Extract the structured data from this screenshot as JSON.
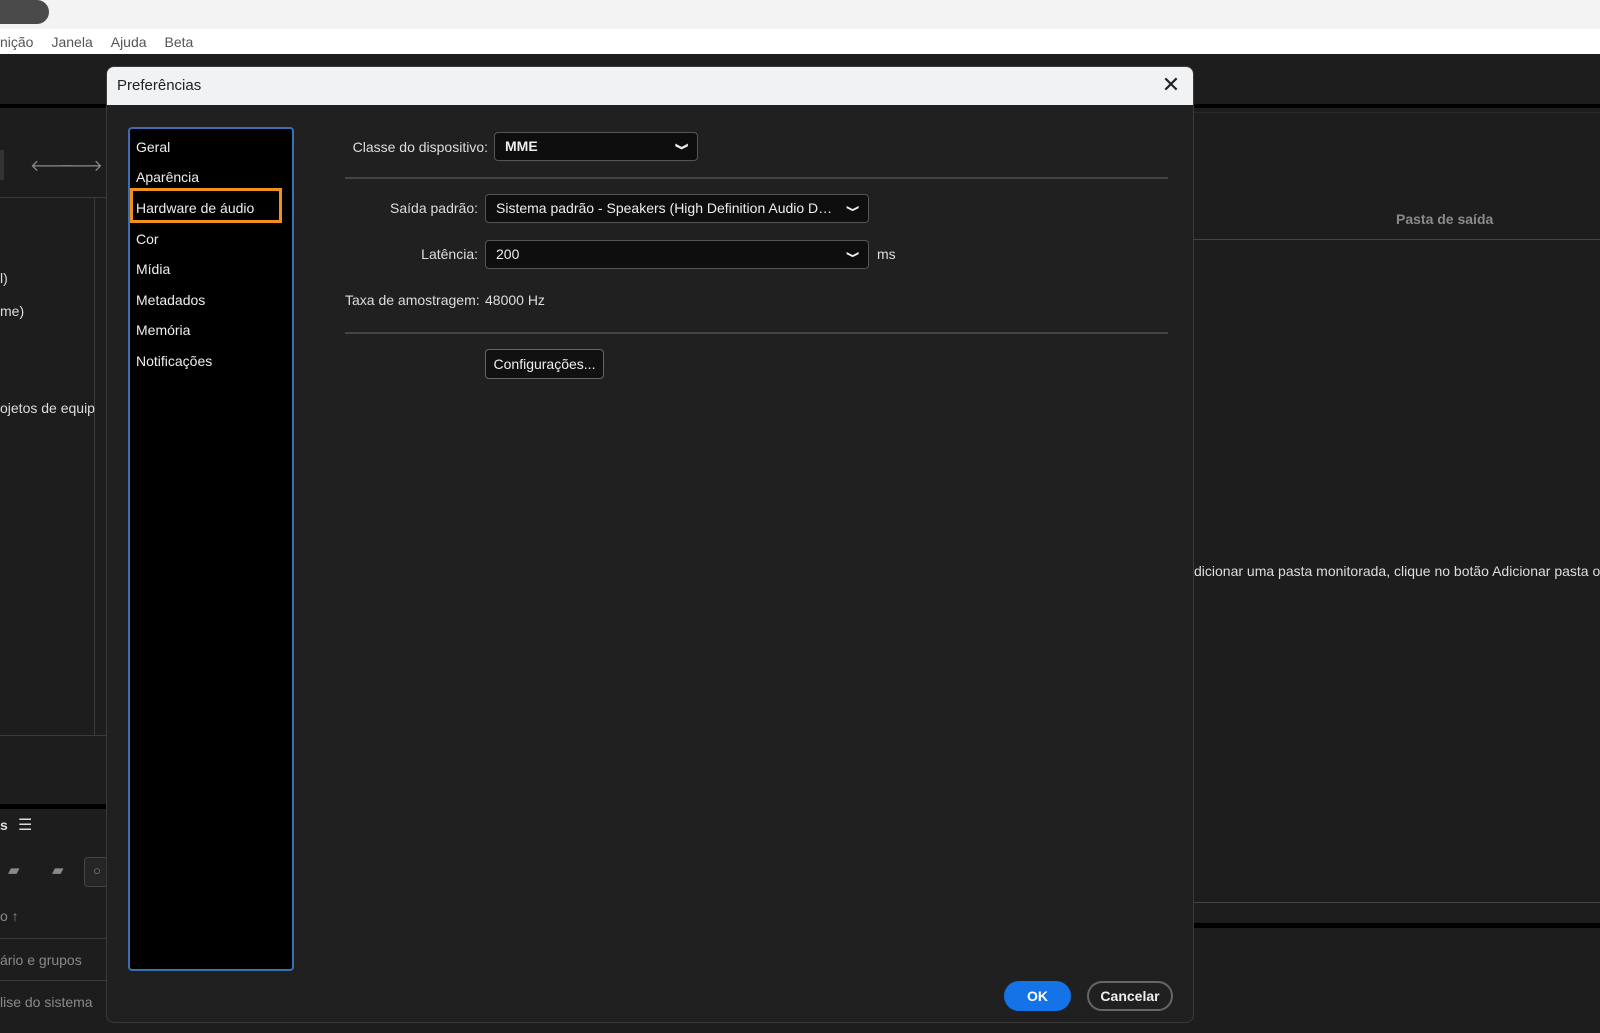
{
  "app_menu": [
    "nição",
    "Janela",
    "Ajuda",
    "Beta"
  ],
  "background": {
    "left_texts": [
      "l)",
      "me)",
      "ojetos de equip"
    ],
    "panel_label": "s",
    "sort_text": "o ↑",
    "bottom_items": [
      "ário e grupos",
      "lise do sistema"
    ],
    "right_header": "Pasta de saída",
    "right_hint": "dicionar uma pasta monitorada, clique no botão Adicionar pasta ou"
  },
  "dialog": {
    "title": "Preferências",
    "nav": [
      "Geral",
      "Aparência",
      "Hardware de áudio",
      "Cor",
      "Mídia",
      "Metadados",
      "Memória",
      "Notificações"
    ],
    "selected_nav": "Hardware de áudio",
    "device_class_label": "Classe do dispositivo:",
    "device_class_value": "MME",
    "default_output_label": "Saída padrão:",
    "default_output_value": "Sistema padrão - Speakers (High Definition Audio De...",
    "latency_label": "Latência:",
    "latency_value": "200",
    "latency_unit": "ms",
    "sample_rate_label": "Taxa de amostragem:",
    "sample_rate_value": "48000 Hz",
    "settings_button": "Configurações...",
    "ok_button": "OK",
    "cancel_button": "Cancelar"
  },
  "colors": {
    "accent": "#1473e6",
    "highlight": "#f39019",
    "nav_border": "#3a6fb3"
  }
}
